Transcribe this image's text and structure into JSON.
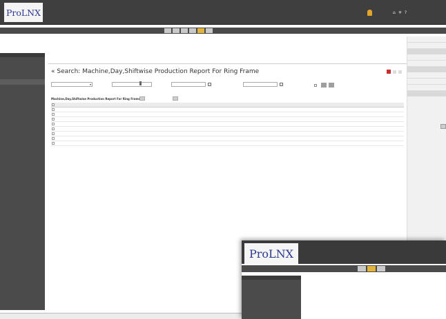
{
  "header": {
    "logo": "ProLNX",
    "version": "",
    "subtitle": "",
    "company": "",
    "user_label": "",
    "nav_links": [
      "",
      "",
      ""
    ],
    "window_title": ""
  },
  "menu": {
    "items": [
      "",
      "",
      "",
      "",
      "",
      ""
    ],
    "active_index": 4
  },
  "sidebar": {
    "header": "",
    "items": [
      "",
      "",
      "",
      "",
      ""
    ],
    "selected_index": 4
  },
  "main": {
    "intro": "",
    "back_link": "",
    "report_title": "Search: Machine,Day,Shiftwise Production Report For Ring Frame",
    "filters": {
      "unit_label": "",
      "unit_value": "",
      "dept_label": "",
      "dept_value": "",
      "from_label": "",
      "from_value": "",
      "to_label": "",
      "to_value": ""
    },
    "summary_label": "",
    "buttons": {
      "search": "",
      "clear": ""
    },
    "grid_title": "Machine,Day,Shiftwise Production Report For Ring Frame",
    "grid_buttons": [
      "",
      ""
    ],
    "pager": "",
    "columns": [
      "",
      "",
      ""
    ],
    "rows": [
      [
        "",
        "",
        ""
      ],
      [
        "",
        "",
        ""
      ],
      [
        "",
        "",
        ""
      ],
      [
        "",
        "",
        ""
      ],
      [
        "",
        "",
        ""
      ],
      [
        "",
        "",
        ""
      ],
      [
        "",
        "",
        ""
      ],
      [
        "",
        "",
        ""
      ]
    ]
  },
  "right_panel": {
    "items": [
      "",
      "",
      "",
      "",
      "",
      "",
      "",
      "",
      "",
      ""
    ]
  },
  "status": {
    "left": "",
    "right": ""
  },
  "overlay": {
    "logo": "ProLNX",
    "version": "",
    "company": "",
    "subtitle": "",
    "menu": [
      "",
      "",
      ""
    ],
    "active_menu": 1,
    "side_header": "",
    "side_items": [
      "",
      "",
      "",
      "",
      ""
    ],
    "text": ""
  }
}
